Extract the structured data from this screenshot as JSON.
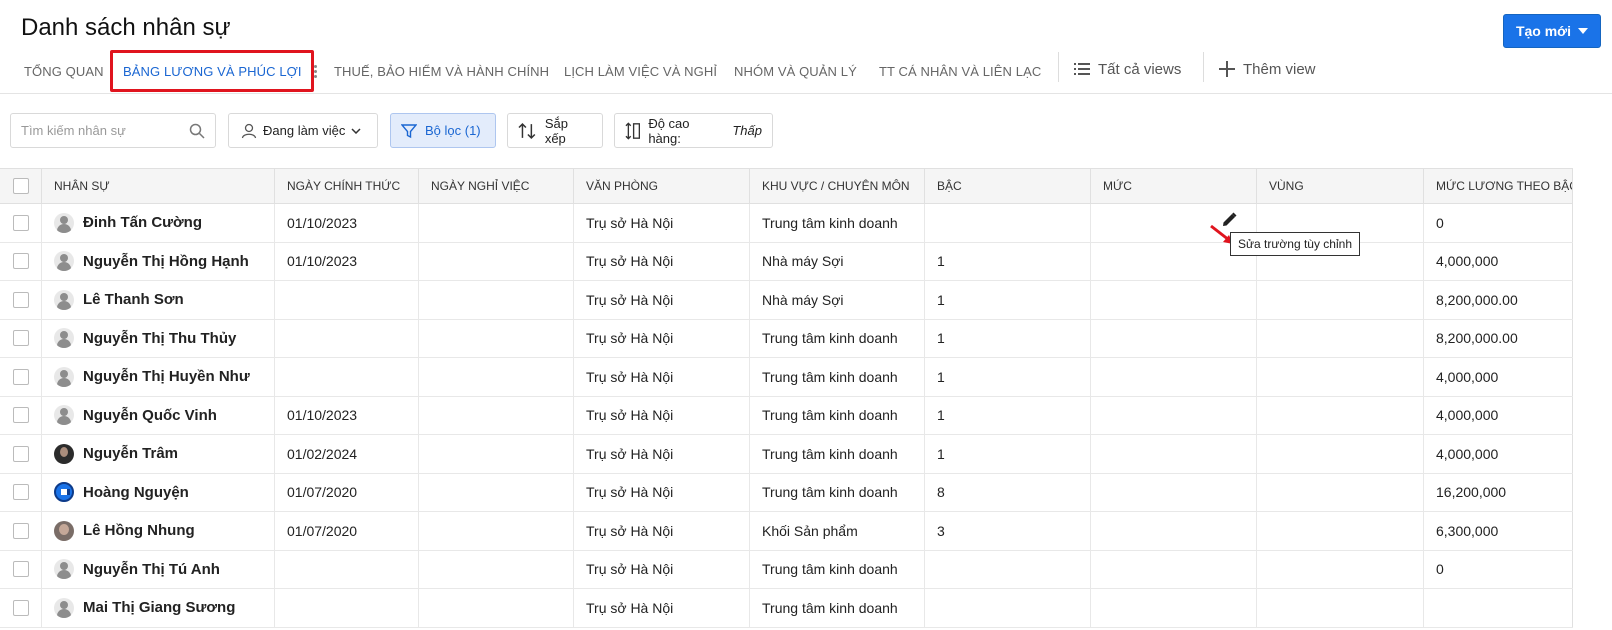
{
  "header": {
    "title": "Danh sách nhân sự",
    "create_label": "Tạo mới"
  },
  "tabs": [
    {
      "label": "TỔNG QUAN"
    },
    {
      "label": "BẢNG LƯƠNG VÀ PHÚC LỢI"
    },
    {
      "label": "THUẾ, BẢO HIỂM VÀ HÀNH CHÍNH"
    },
    {
      "label": "LỊCH LÀM VIỆC VÀ NGHỈ"
    },
    {
      "label": "NHÓM VÀ QUẢN LÝ"
    },
    {
      "label": "TT CÁ NHÂN VÀ LIÊN LẠC"
    }
  ],
  "views": {
    "all_label": "Tất cả views",
    "add_label": "Thêm view"
  },
  "toolbar": {
    "search_placeholder": "Tìm kiếm nhân sự",
    "status_label": "Đang làm việc",
    "filter_label": "Bộ lọc (1)",
    "sort_label": "Sắp xếp",
    "row_height_label": "Độ cao hàng:",
    "row_height_value": "Thấp"
  },
  "columns": [
    "NHÂN SỰ",
    "NGÀY CHÍNH THỨC",
    "NGÀY NGHỈ VIỆC",
    "VĂN PHÒNG",
    "KHU VỰC / CHUYÊN MÔN",
    "BẬC",
    "MỨC",
    "VÙNG",
    "MỨC LƯƠNG THEO BẬC"
  ],
  "rows": [
    {
      "name": "Đinh Tấn Cường",
      "start": "01/10/2023",
      "end": "",
      "office": "Trụ sở Hà Nội",
      "area": "Trung tâm kinh doanh",
      "grade": "",
      "level": "",
      "region": "",
      "salary": "0"
    },
    {
      "name": "Nguyễn Thị Hồng Hạnh",
      "start": "01/10/2023",
      "end": "",
      "office": "Trụ sở Hà Nội",
      "area": "Nhà máy Sợi",
      "grade": "1",
      "level": "",
      "region": "",
      "salary": "4,000,000"
    },
    {
      "name": "Lê Thanh Sơn",
      "start": "",
      "end": "",
      "office": "Trụ sở Hà Nội",
      "area": "Nhà máy Sợi",
      "grade": "1",
      "level": "",
      "region": "",
      "salary": "8,200,000.00"
    },
    {
      "name": "Nguyễn Thị Thu Thủy",
      "start": "",
      "end": "",
      "office": "Trụ sở Hà Nội",
      "area": "Trung tâm kinh doanh",
      "grade": "1",
      "level": "",
      "region": "",
      "salary": "8,200,000.00"
    },
    {
      "name": "Nguyễn Thị Huyền Như",
      "start": "",
      "end": "",
      "office": "Trụ sở Hà Nội",
      "area": "Trung tâm kinh doanh",
      "grade": "1",
      "level": "",
      "region": "",
      "salary": "4,000,000"
    },
    {
      "name": "Nguyễn Quốc Vinh",
      "start": "01/10/2023",
      "end": "",
      "office": "Trụ sở Hà Nội",
      "area": "Trung tâm kinh doanh",
      "grade": "1",
      "level": "",
      "region": "",
      "salary": "4,000,000"
    },
    {
      "name": "Nguyễn Trâm",
      "start": "01/02/2024",
      "end": "",
      "office": "Trụ sở Hà Nội",
      "area": "Trung tâm kinh doanh",
      "grade": "1",
      "level": "",
      "region": "",
      "salary": "4,000,000"
    },
    {
      "name": "Hoàng Nguyện",
      "start": "01/07/2020",
      "end": "",
      "office": "Trụ sở Hà Nội",
      "area": "Trung tâm kinh doanh",
      "grade": "8",
      "level": "",
      "region": "",
      "salary": "16,200,000"
    },
    {
      "name": "Lê Hồng Nhung",
      "start": "01/07/2020",
      "end": "",
      "office": "Trụ sở Hà Nội",
      "area": "Khối Sản phẩm",
      "grade": "3",
      "level": "",
      "region": "",
      "salary": "6,300,000"
    },
    {
      "name": "Nguyễn Thị Tú Anh",
      "start": "",
      "end": "",
      "office": "Trụ sở Hà Nội",
      "area": "Trung tâm kinh doanh",
      "grade": "",
      "level": "",
      "region": "",
      "salary": "0"
    },
    {
      "name": "Mai Thị Giang Sương",
      "start": "",
      "end": "",
      "office": "Trụ sở Hà Nội",
      "area": "Trung tâm kinh doanh",
      "grade": "",
      "level": "",
      "region": "",
      "salary": ""
    }
  ],
  "tooltip": {
    "label": "Sửa trường tùy chỉnh"
  },
  "colors": {
    "accent": "#1a73e8",
    "highlight": "#e0141e"
  }
}
